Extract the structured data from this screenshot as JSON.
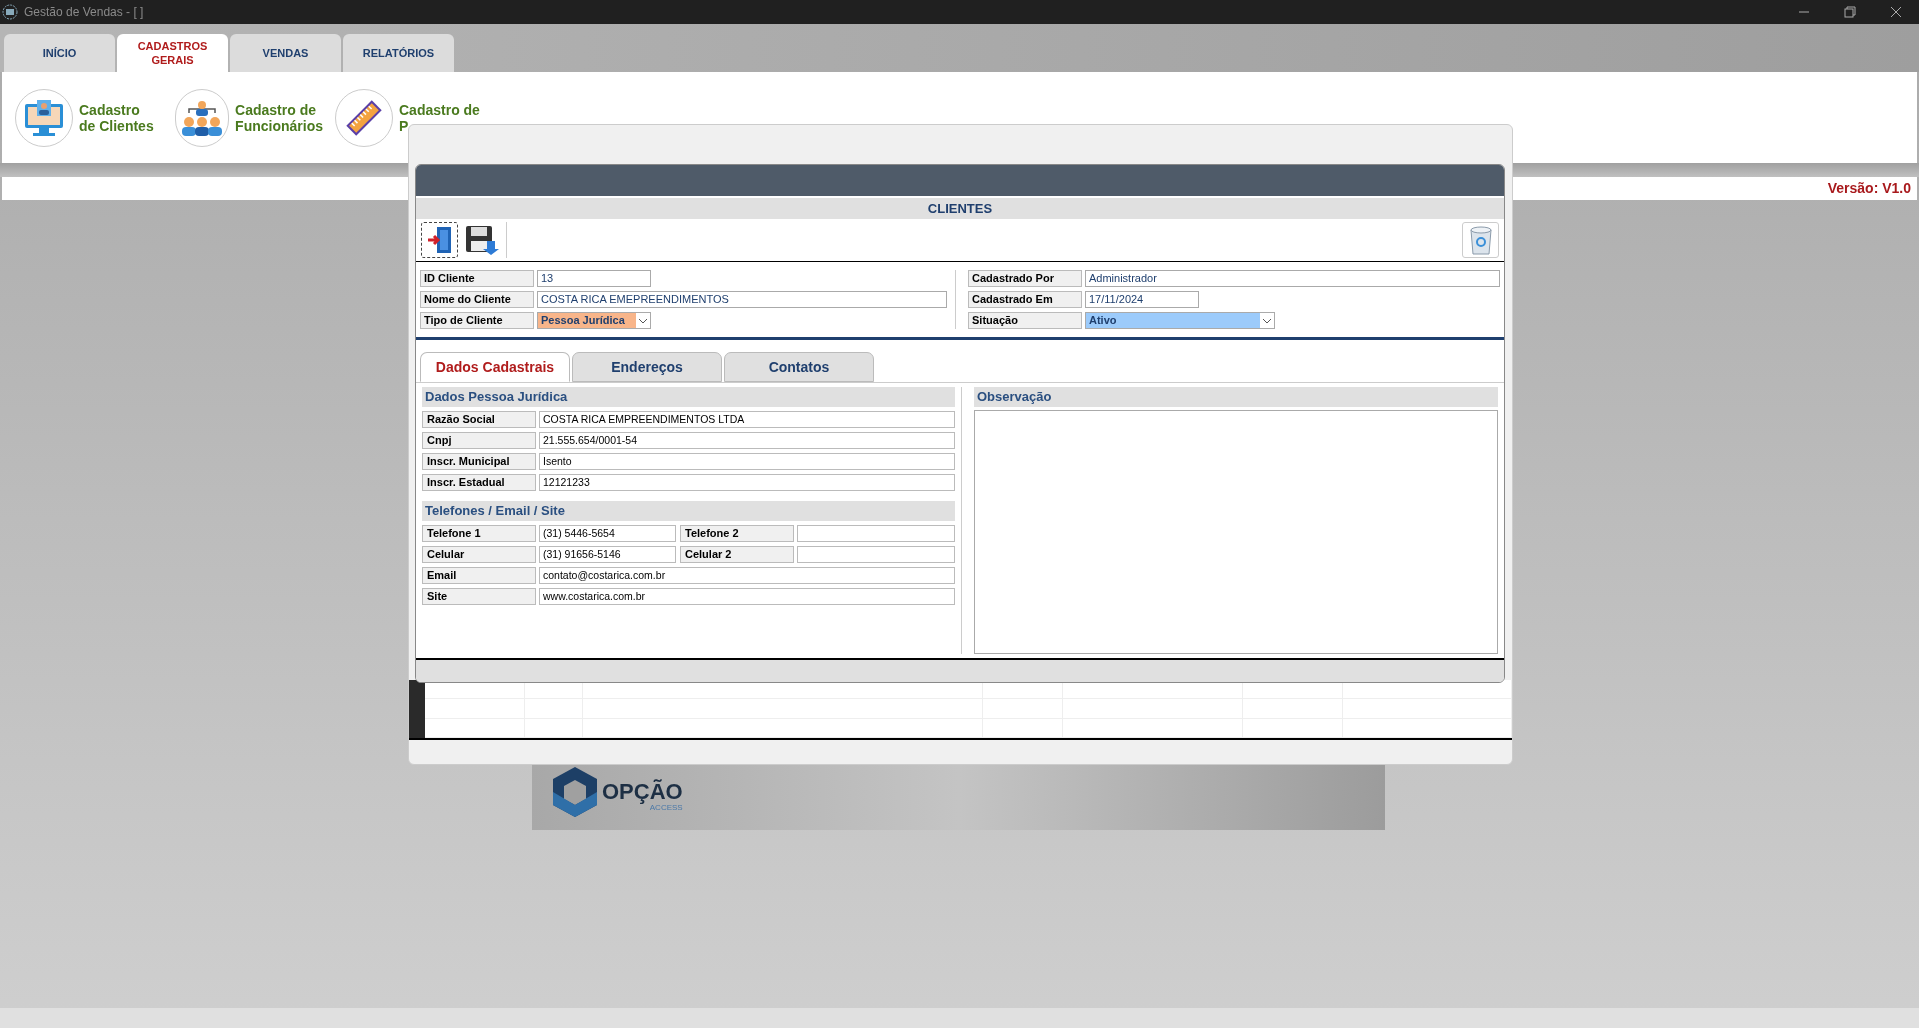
{
  "window": {
    "title": "Gestão de Vendas - [ ]"
  },
  "main_tabs": [
    {
      "lines": [
        "INÍCIO"
      ],
      "selected": false
    },
    {
      "lines": [
        "CADASTROS",
        "GERAIS"
      ],
      "selected": true
    },
    {
      "lines": [
        "VENDAS"
      ],
      "selected": false
    },
    {
      "lines": [
        "RELATÓRIOS"
      ],
      "selected": false
    }
  ],
  "ribbon_items": [
    {
      "kind": "monitor",
      "lines": [
        "Cadastro",
        "de Clientes"
      ]
    },
    {
      "kind": "team",
      "lines": [
        "Cadastro de",
        "Funcionários"
      ]
    },
    {
      "kind": "ruler",
      "lines": [
        "Cadastro de",
        "P"
      ]
    }
  ],
  "version": "Versão: V1.0",
  "dialog": {
    "title": "CLIENTES",
    "fields_left": [
      {
        "label": "ID Cliente",
        "value": "13",
        "kind": "short"
      },
      {
        "label": "Nome do Cliente",
        "value": "COSTA RICA EMEPREENDIMENTOS",
        "kind": "long"
      },
      {
        "label": "Tipo de Cliente",
        "value": "Pessoa Jurídica",
        "kind": "select",
        "color": "#f8b58a"
      }
    ],
    "fields_right": [
      {
        "label": "Cadastrado Por",
        "value": "Administrador",
        "kind": "long"
      },
      {
        "label": "Cadastrado Em",
        "value": "17/11/2024",
        "kind": "short"
      },
      {
        "label": "Situação",
        "value": "Ativo",
        "kind": "select",
        "color": "#9ccbfb"
      }
    ],
    "tabs": [
      {
        "label": "Dados Cadastrais",
        "selected": true
      },
      {
        "label": "Endereços",
        "selected": false
      },
      {
        "label": "Contatos",
        "selected": false
      }
    ],
    "company": {
      "title": "Dados Pessoa Jurídica",
      "rows": [
        {
          "label": "Razão Social",
          "value": "COSTA RICA EMPREENDIMENTOS LTDA"
        },
        {
          "label": "Cnpj",
          "value": "21.555.654/0001-54"
        },
        {
          "label": "Inscr. Municipal",
          "value": "Isento"
        },
        {
          "label": "Inscr. Estadual",
          "value": "12121233"
        }
      ]
    },
    "contact": {
      "title": "Telefones / Email / Site",
      "rows": [
        [
          {
            "label": "Telefone 1",
            "value": "(31) 5446-5654"
          },
          {
            "label": "Telefone 2"
          }
        ],
        [
          {
            "label": "Celular",
            "value": "(31) 91656-5146"
          },
          {
            "label": "Celular 2"
          }
        ],
        [
          {
            "label": "Email",
            "value": "contato@costarica.com.br"
          }
        ],
        [
          {
            "label": "Site",
            "value": "www.costarica.com.br"
          }
        ]
      ]
    },
    "notes": {
      "title": "Observação"
    }
  },
  "logo": {
    "name": "OPÇÃO",
    "tagline": "ACCESS"
  }
}
